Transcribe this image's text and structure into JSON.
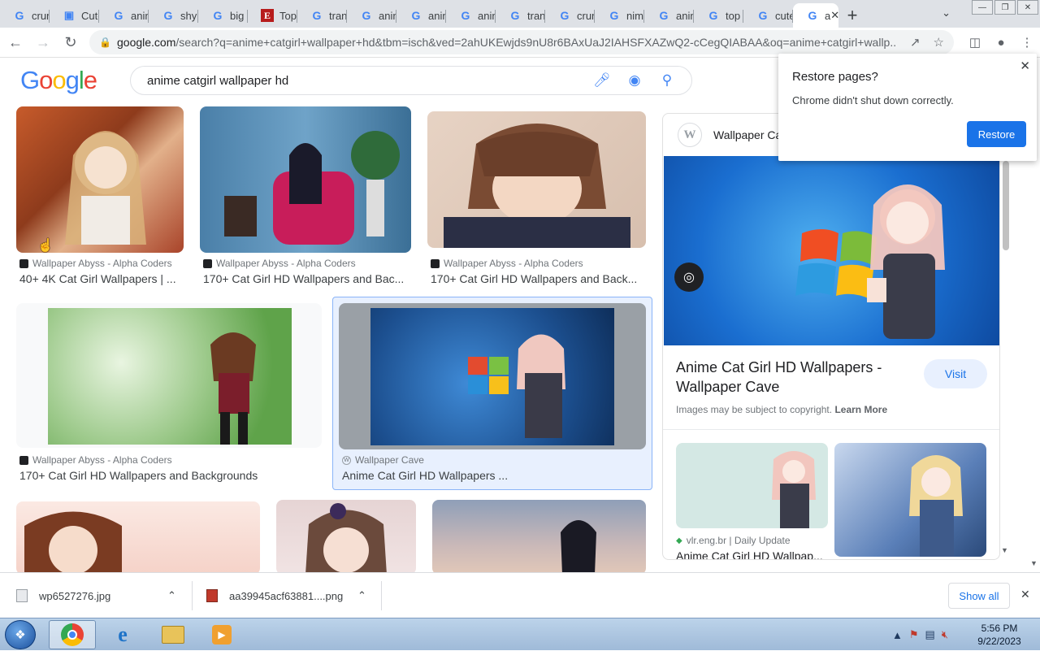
{
  "browser": {
    "tabs": [
      {
        "favicon": "google-icon",
        "label": "crun"
      },
      {
        "favicon": "cute-icon",
        "label": "Cute"
      },
      {
        "favicon": "google-icon",
        "label": "anin"
      },
      {
        "favicon": "google-icon",
        "label": "shy"
      },
      {
        "favicon": "google-icon",
        "label": "big"
      },
      {
        "favicon": "e-icon",
        "label": "Top"
      },
      {
        "favicon": "google-icon",
        "label": "tran"
      },
      {
        "favicon": "google-icon",
        "label": "anin"
      },
      {
        "favicon": "google-icon",
        "label": "anin"
      },
      {
        "favicon": "google-icon",
        "label": "anin"
      },
      {
        "favicon": "google-icon",
        "label": "tran"
      },
      {
        "favicon": "google-icon",
        "label": "crun"
      },
      {
        "favicon": "google-icon",
        "label": "nim"
      },
      {
        "favicon": "google-icon",
        "label": "anin"
      },
      {
        "favicon": "google-icon",
        "label": "top"
      },
      {
        "favicon": "google-icon",
        "label": "cute"
      },
      {
        "favicon": "google-icon",
        "label": "a"
      }
    ],
    "address_domain": "google.com",
    "address_path": "/search?q=anime+catgirl+wallpaper+hd&tbm=isch&ved=2ahUKEwjds9nU8r6BAxUaJ2IAHSFXAZwQ2-cCegQIABAA&oq=anime+catgirl+wallp..."
  },
  "google": {
    "logo": "Google",
    "query": "anime catgirl wallpaper hd"
  },
  "results": [
    {
      "source": "Wallpaper Abyss - Alpha Coders",
      "title": "40+ 4K Cat Girl Wallpapers | ..."
    },
    {
      "source": "Wallpaper Abyss - Alpha Coders",
      "title": "170+ Cat Girl HD Wallpapers and Bac..."
    },
    {
      "source": "Wallpaper Abyss - Alpha Coders",
      "title": "170+ Cat Girl HD Wallpapers and Back..."
    },
    {
      "source": "Wallpaper Abyss - Alpha Coders",
      "title": "170+ Cat Girl HD Wallpapers and Backgrounds"
    },
    {
      "source": "Wallpaper Cave",
      "title": "Anime Cat Girl HD Wallpapers ..."
    }
  ],
  "panel": {
    "site": "Wallpaper Ca",
    "title": "Anime Cat Girl HD Wallpapers - Wallpaper Cave",
    "visit": "Visit",
    "copyright": "Images may be subject to copyright.",
    "learn_more": "Learn More",
    "related_source": "vlr.eng.br | Daily Update",
    "related_title": "Anime Cat Girl HD Wallpap..."
  },
  "popup": {
    "title": "Restore pages?",
    "message": "Chrome didn't shut down correctly.",
    "button": "Restore"
  },
  "downloads": {
    "items": [
      {
        "filename": "wp6527276.jpg"
      },
      {
        "filename": "aa39945acf63881....png"
      }
    ],
    "show_all": "Show all"
  },
  "taskbar": {
    "time": "5:56 PM",
    "date": "9/22/2023"
  }
}
